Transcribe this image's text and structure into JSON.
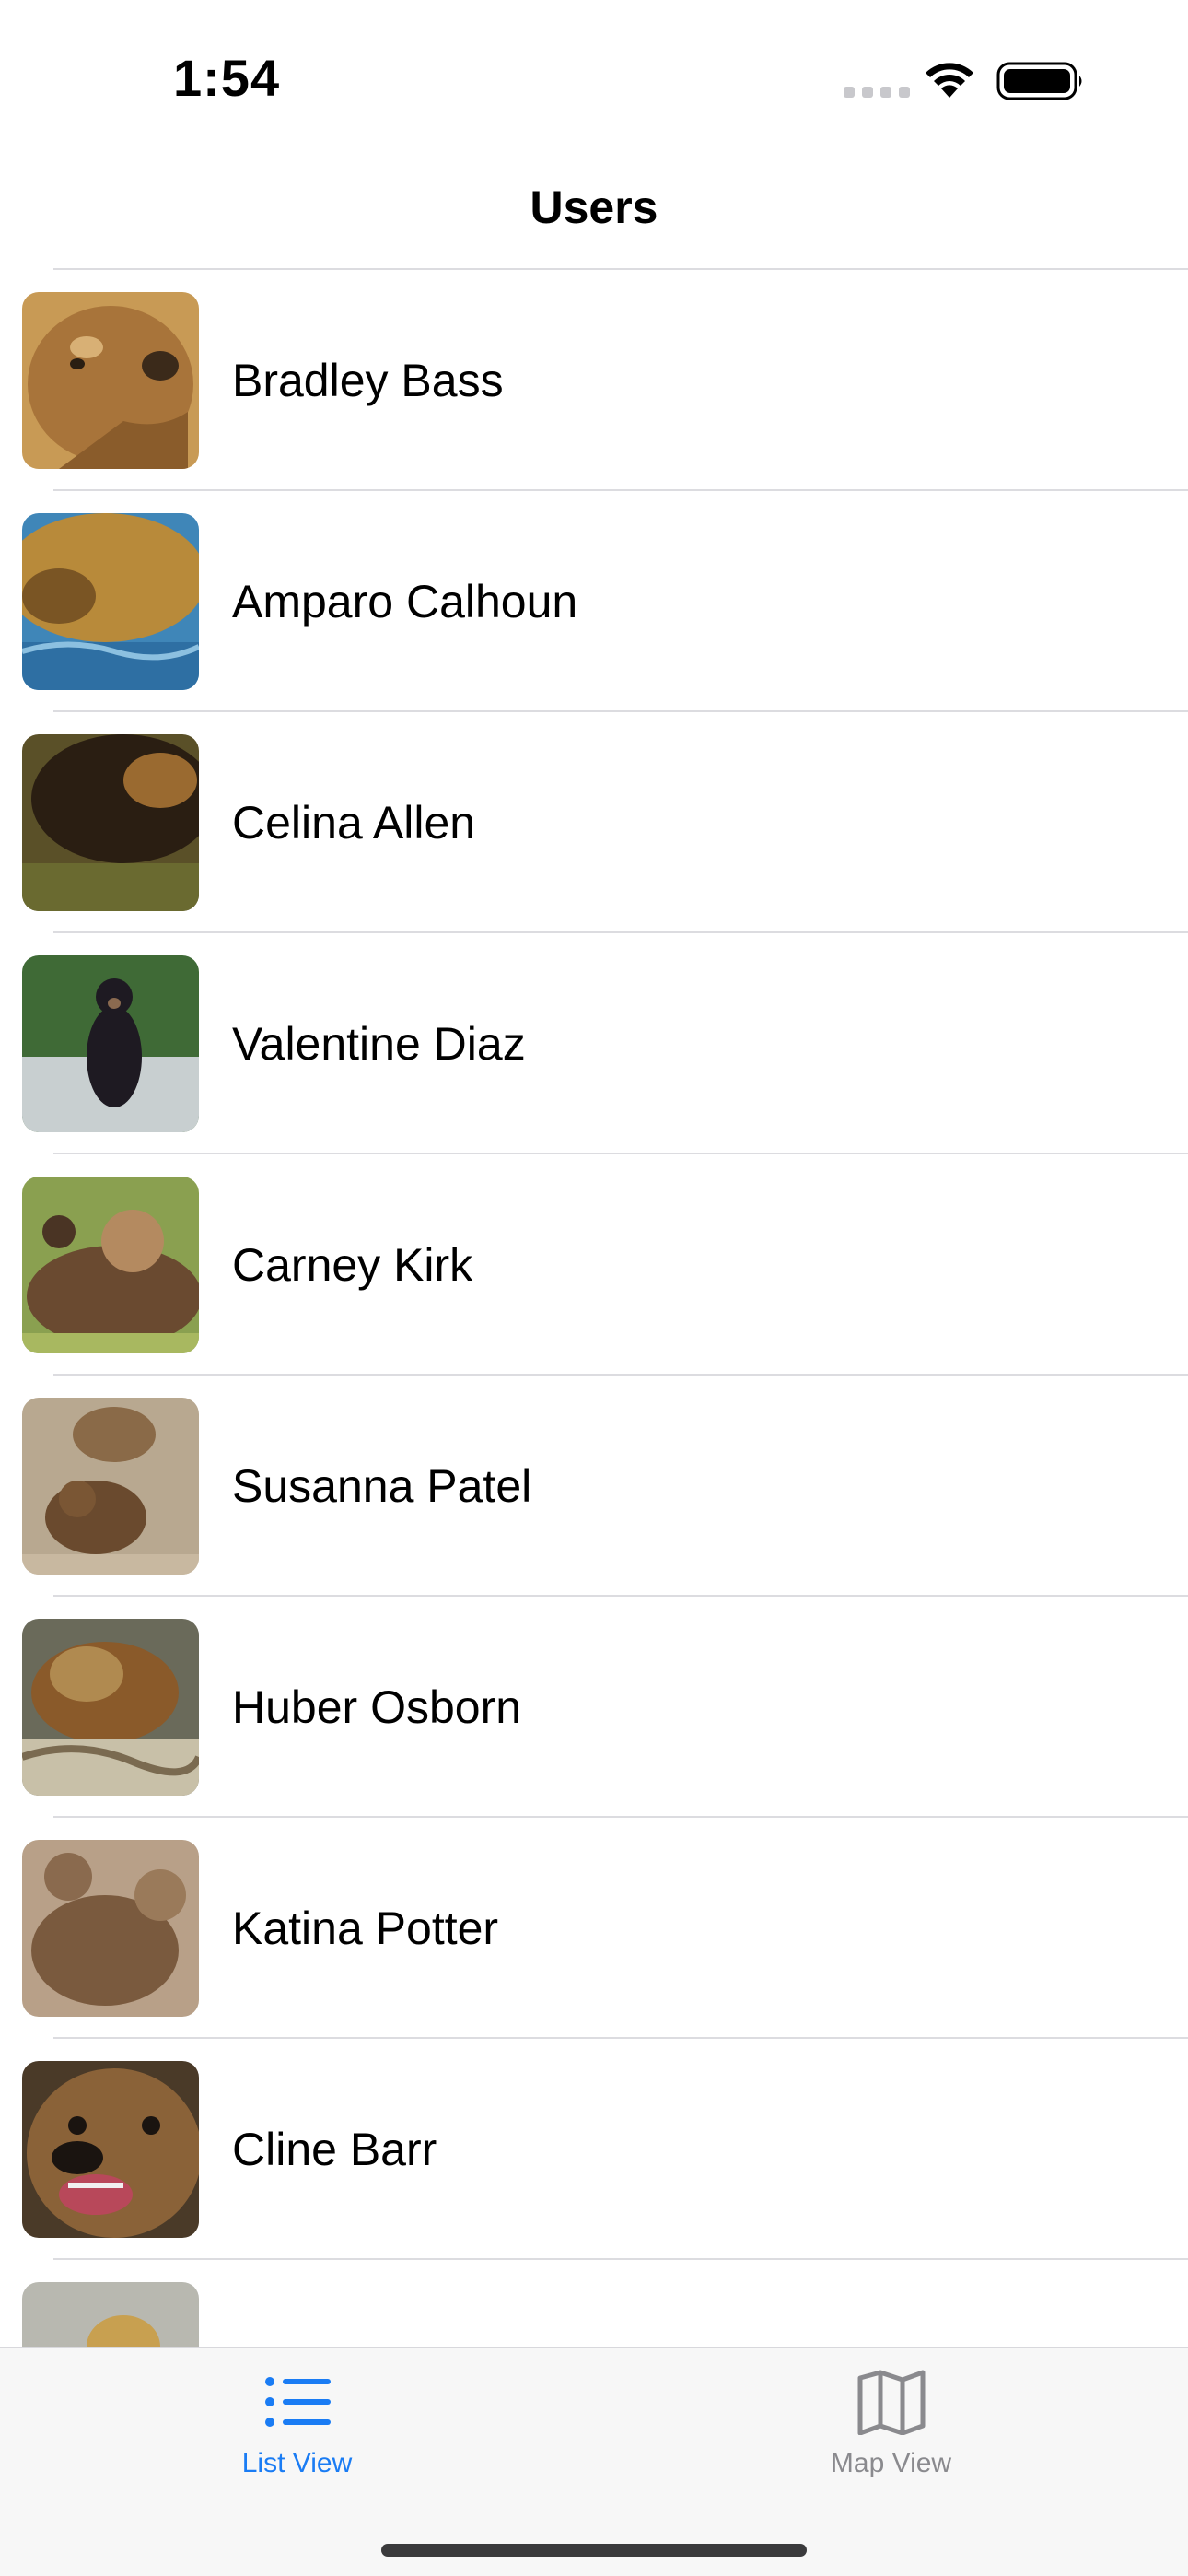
{
  "status_bar": {
    "time": "1:54",
    "icons": [
      "signal-dots-icon",
      "wifi-icon",
      "battery-icon"
    ]
  },
  "nav": {
    "title": "Users"
  },
  "users": [
    {
      "name": "Bradley Bass",
      "avatar": "bear-photo"
    },
    {
      "name": "Amparo Calhoun",
      "avatar": "bear-photo"
    },
    {
      "name": "Celina Allen",
      "avatar": "bear-photo"
    },
    {
      "name": "Valentine Diaz",
      "avatar": "bear-photo"
    },
    {
      "name": "Carney Kirk",
      "avatar": "bear-photo"
    },
    {
      "name": "Susanna Patel",
      "avatar": "bear-photo"
    },
    {
      "name": "Huber Osborn",
      "avatar": "bear-photo"
    },
    {
      "name": "Katina Potter",
      "avatar": "bear-photo"
    },
    {
      "name": "Cline Barr",
      "avatar": "bear-photo"
    },
    {
      "name": "",
      "avatar": "bear-photo"
    }
  ],
  "tabs": [
    {
      "label": "List View",
      "icon": "list-icon",
      "selected": true
    },
    {
      "label": "Map View",
      "icon": "map-icon",
      "selected": false
    }
  ],
  "colors": {
    "accent": "#1a7cf4",
    "inactive": "#8a8a8e",
    "separator": "#dcdce0"
  }
}
